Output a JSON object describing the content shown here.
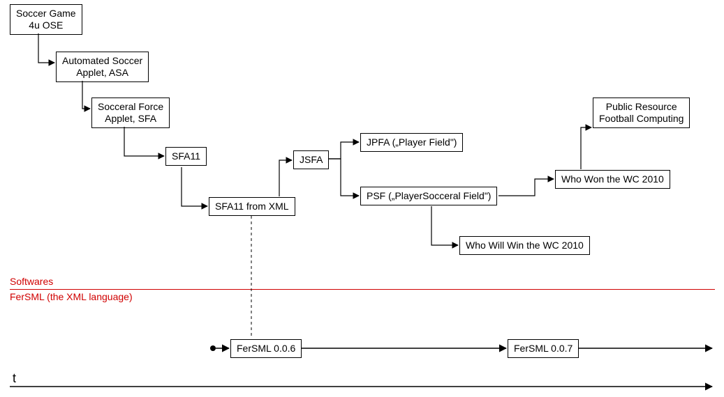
{
  "nodes": {
    "sg4u": "Soccer Game\n4u OSE",
    "asa": "Automated Soccer\nApplet, ASA",
    "sfa": "Socceral Force\nApplet, SFA",
    "sfa11": "SFA11",
    "sfa11x": "SFA11 from XML",
    "jsfa": "JSFA",
    "jpfa": "JPFA („Player Field\")",
    "psf": "PSF („PlayerSocceral Field\")",
    "wwwc": "Who Will Win the WC 2010",
    "prfc": "Public Resource\nFootball Computing",
    "wwon": "Who Won the WC 2010",
    "fsm06": "FerSML 0.0.6",
    "fsm07": "FerSML 0.0.7"
  },
  "labels": {
    "softwares": "Softwares",
    "fersml": "FerSML (the XML language)",
    "t": "t"
  }
}
